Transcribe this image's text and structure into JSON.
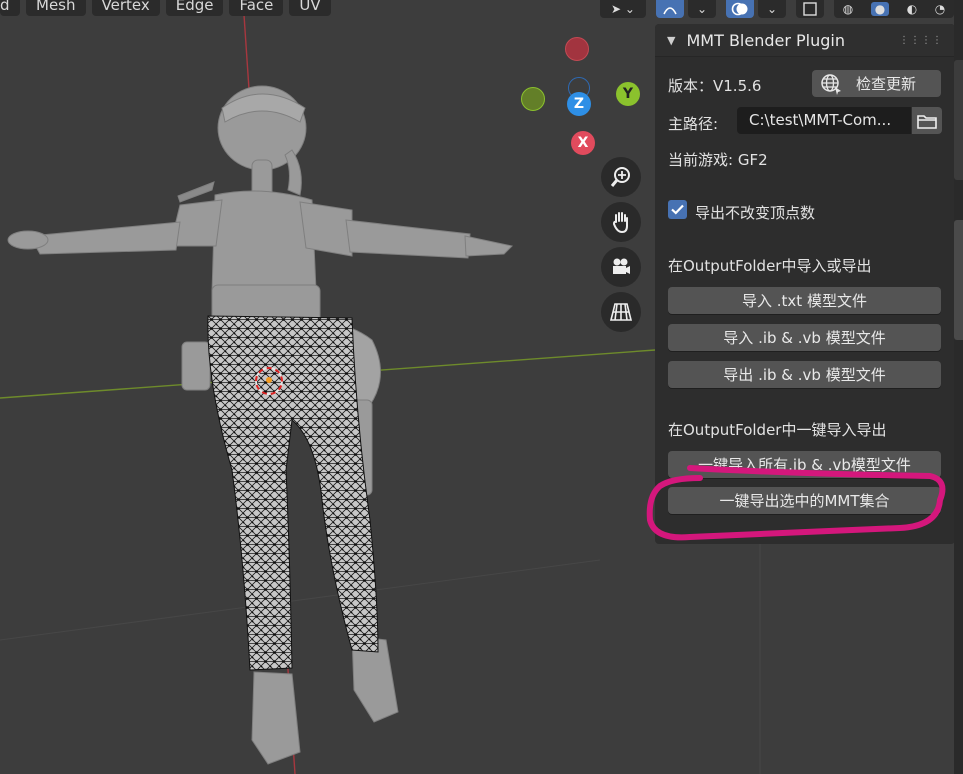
{
  "header": {
    "menus": [
      "d",
      "Mesh",
      "Vertex",
      "Edge",
      "Face",
      "UV"
    ]
  },
  "gizmo": {
    "axis_labels": {
      "y": "Y",
      "z": "Z",
      "x": "X"
    },
    "colors": {
      "x": "#e14b5d",
      "y": "#8bc22d",
      "z": "#2e8fe6"
    }
  },
  "panel": {
    "title": "MMT Blender Plugin",
    "version_label": "版本：V1.5.6",
    "check_update_label": "检查更新",
    "main_path_label": "主路径:",
    "main_path_value": "C:\\test\\MMT-Com...",
    "current_game_label": "当前游戏: GF2",
    "checkbox_label": "导出不改变顶点数",
    "checkbox_checked": true,
    "section1_title": "在OutputFolder中导入或导出",
    "buttons1": [
      "导入 .txt 模型文件",
      "导入 .ib & .vb 模型文件",
      "导出 .ib & .vb 模型文件"
    ],
    "section2_title": "在OutputFolder中一键导入导出",
    "import_all_label": "一键导入所有.ib & .vb模型文件",
    "export_selected_label": "一键导出选中的MMT集合"
  },
  "colors": {
    "accent": "#4772b3",
    "annotation": "#d4177c",
    "viewport_bg": "#3d3d3d",
    "panel_bg": "#2d2d2d"
  }
}
